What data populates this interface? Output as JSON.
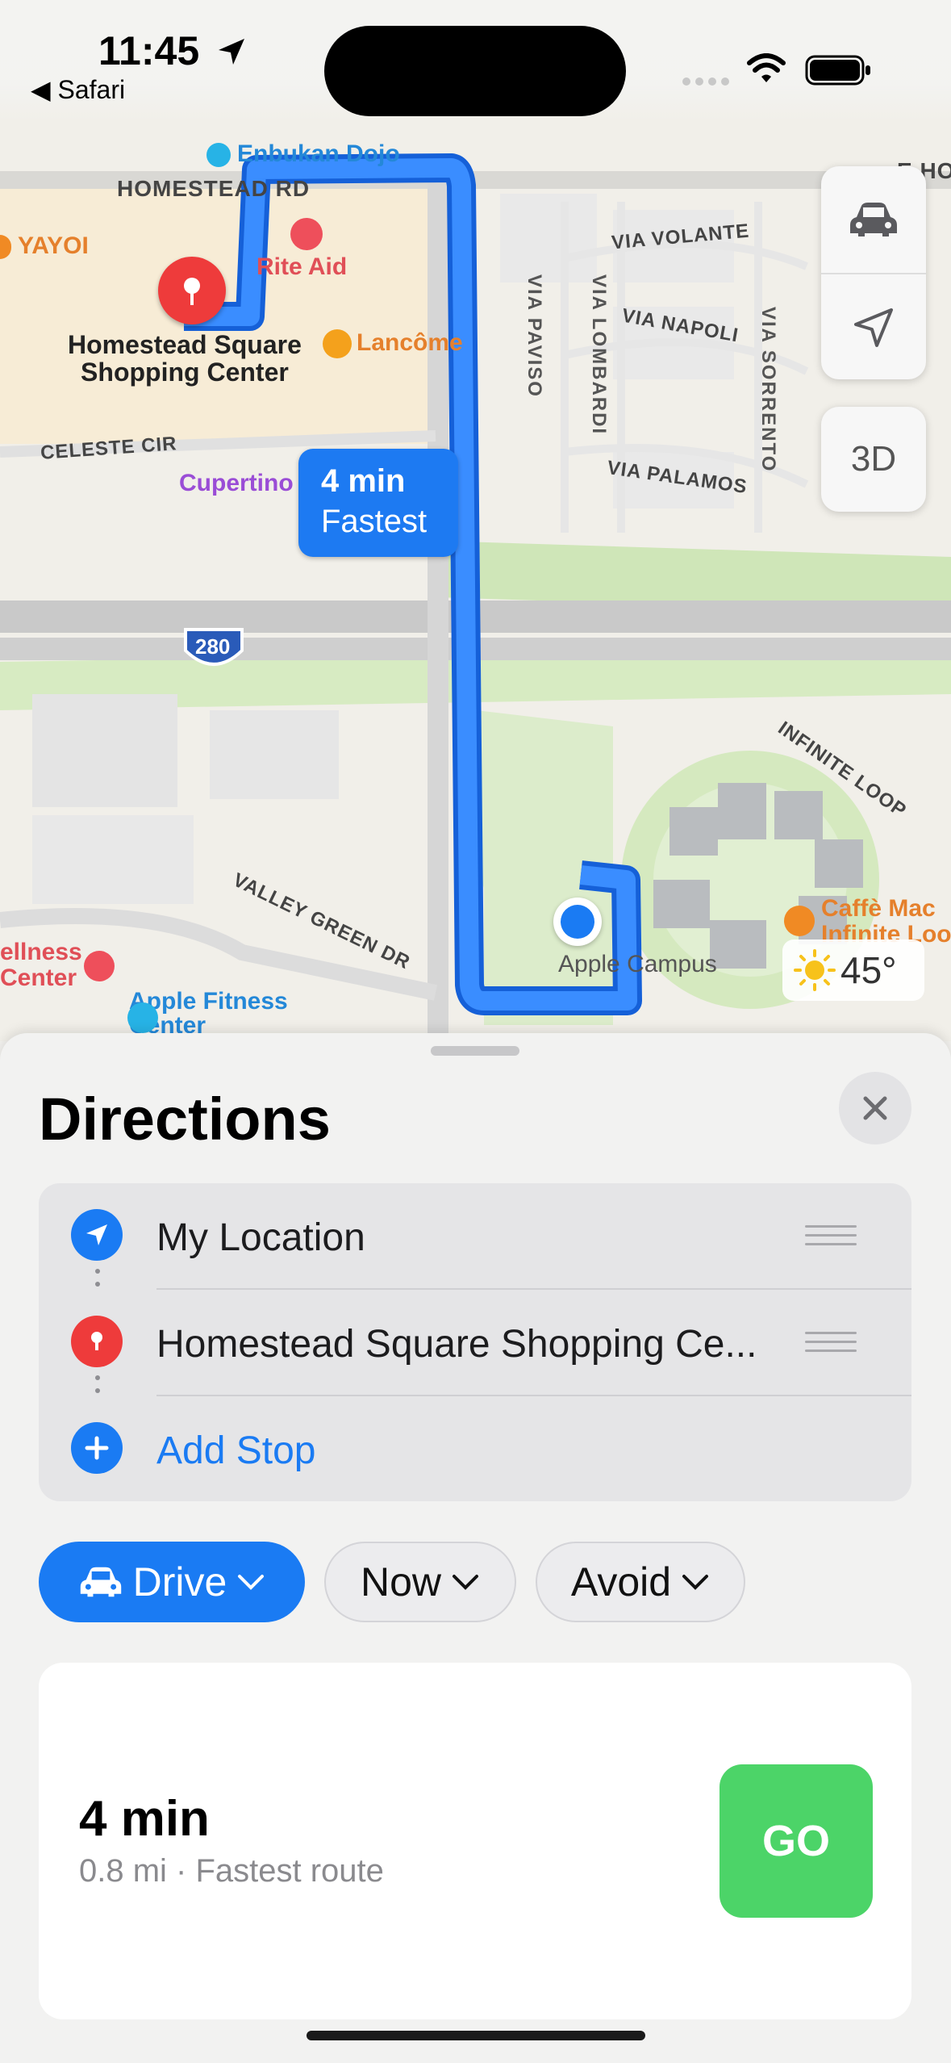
{
  "status_bar": {
    "time": "11:45",
    "back_app": "◀ Safari"
  },
  "map": {
    "road_labels": {
      "homestead_rd": "HOMESTEAD RD",
      "celeste_cir": "CELESTE CIR",
      "via_volante": "VIA VOLANTE",
      "via_napoli": "VIA NAPOLI",
      "via_palamos": "VIA PALAMOS",
      "via_paviso": "VIA PAVISO",
      "via_lombardi": "VIA LOMBARDI",
      "via_sorrento": "VIA SORRENTO",
      "infinite_loop": "INFINITE LOOP",
      "valley_green_dr": "VALLEY GREEN DR",
      "e_ho": "E HO",
      "highway": "280"
    },
    "pois": {
      "enbukan": "Enbukan Dojo",
      "yayoi": "YAYOI",
      "rite_aid": "Rite Aid",
      "homestead_square_1": "Homestead Square",
      "homestead_square_2": "Shopping Center",
      "lancome": "Lancôme",
      "cupertino": "Cupertino",
      "wellness_1": "ellness",
      "wellness_2": "Center",
      "apple_fitness_1": "Apple Fitness",
      "apple_fitness_2": "Center",
      "apple_campus": "Apple Campus",
      "caffe_1": "Caffè Mac",
      "caffe_2": "Infinite Loo"
    },
    "route_callout": {
      "duration": "4 min",
      "label": "Fastest"
    },
    "controls": {
      "view_3d": "3D"
    },
    "weather": {
      "temperature": "45°",
      "icon": "sun-icon"
    }
  },
  "sheet": {
    "title": "Directions",
    "stops": [
      {
        "label": "My Location",
        "icon": "location-arrow-icon"
      },
      {
        "label": "Homestead Square Shopping Ce...",
        "icon": "pin-icon"
      },
      {
        "label": "Add Stop",
        "icon": "plus-icon"
      }
    ],
    "options": {
      "mode": "Drive",
      "time": "Now",
      "avoid": "Avoid"
    },
    "route": {
      "eta": "4 min",
      "details": "0.8 mi · Fastest route",
      "go_label": "GO"
    }
  },
  "colors": {
    "accent": "#1a7bf3",
    "go_green": "#4cd468",
    "pin_red": "#ee3b3b"
  }
}
